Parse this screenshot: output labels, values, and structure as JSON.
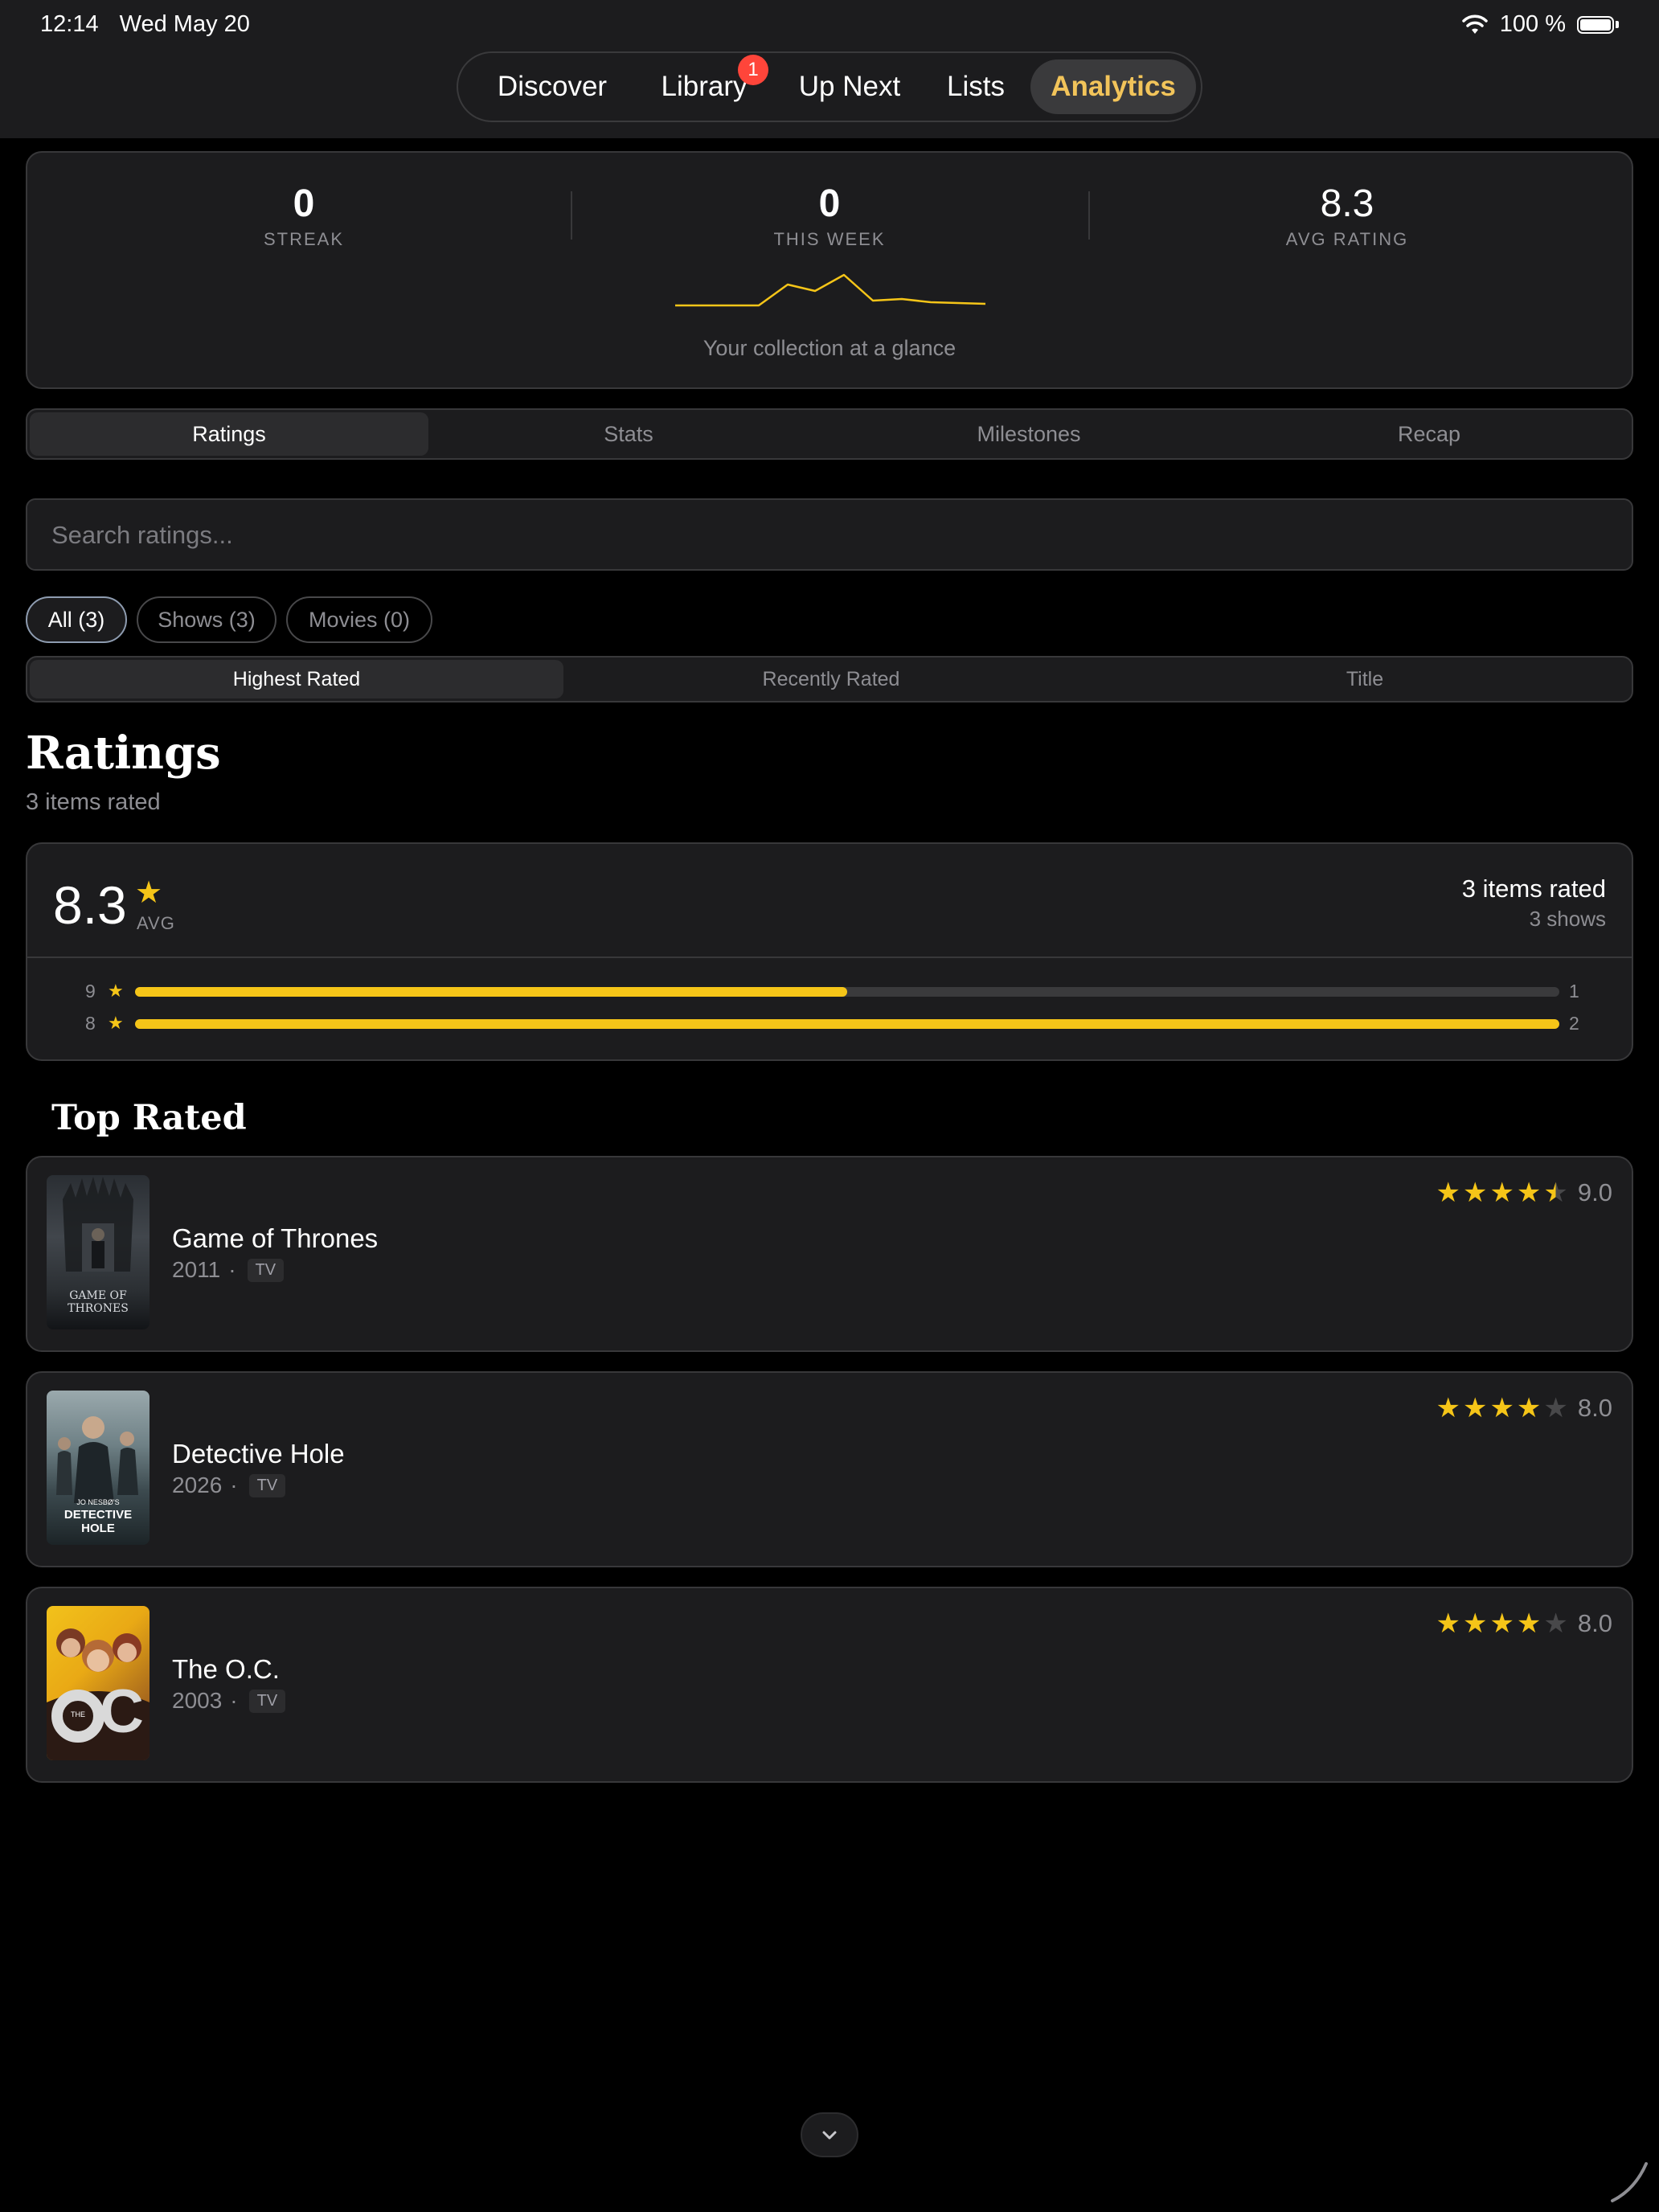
{
  "status_bar": {
    "time": "12:14",
    "date": "Wed May 20",
    "battery": "100 %"
  },
  "nav": {
    "items": [
      "Discover",
      "Library",
      "Up Next",
      "Lists",
      "Analytics"
    ],
    "active": "Analytics",
    "library_badge": "1"
  },
  "summary": {
    "stats": [
      {
        "value": "0",
        "label": "STREAK"
      },
      {
        "value": "0",
        "label": "THIS WEEK"
      },
      {
        "value": "8.3",
        "label": "AVG RATING"
      }
    ],
    "caption": "Your collection at a glance",
    "accent_color": "#f5c518"
  },
  "tabs": {
    "items": [
      "Ratings",
      "Stats",
      "Milestones",
      "Recap"
    ],
    "active": "Ratings"
  },
  "search": {
    "placeholder": "Search ratings..."
  },
  "filters": {
    "items": [
      "All (3)",
      "Shows (3)",
      "Movies (0)"
    ],
    "active": "All (3)"
  },
  "sort": {
    "items": [
      "Highest Rated",
      "Recently Rated",
      "Title"
    ],
    "active": "Highest Rated"
  },
  "ratings_header": {
    "title": "Ratings",
    "subtitle": "3 items rated"
  },
  "average_card": {
    "value": "8.3",
    "label": "AVG",
    "right_title": "3 items rated",
    "right_sub": "3 shows",
    "distribution": [
      {
        "rating": "9",
        "count": "1",
        "fraction": 0.5
      },
      {
        "rating": "8",
        "count": "2",
        "fraction": 1.0
      }
    ]
  },
  "top_rated": {
    "title": "Top Rated",
    "items": [
      {
        "title": "Game of Thrones",
        "year": "2011",
        "type": "TV",
        "score": "9.0",
        "stars": 4.5
      },
      {
        "title": "Detective Hole",
        "year": "2026",
        "type": "TV",
        "score": "8.0",
        "stars": 4
      },
      {
        "title": "The O.C.",
        "year": "2003",
        "type": "TV",
        "score": "8.0",
        "stars": 4
      }
    ]
  },
  "poster_art": {
    "got": "GAME OF THRONES",
    "hole_pre": "JO NESBØ'S",
    "hole": "DETECTIVE HOLE",
    "oc_small": "THE",
    "oc": "OC"
  },
  "icons": {
    "wifi": "wifi-icon",
    "battery": "battery-icon",
    "star": "star-icon",
    "chevron": "chevron-down-icon"
  }
}
